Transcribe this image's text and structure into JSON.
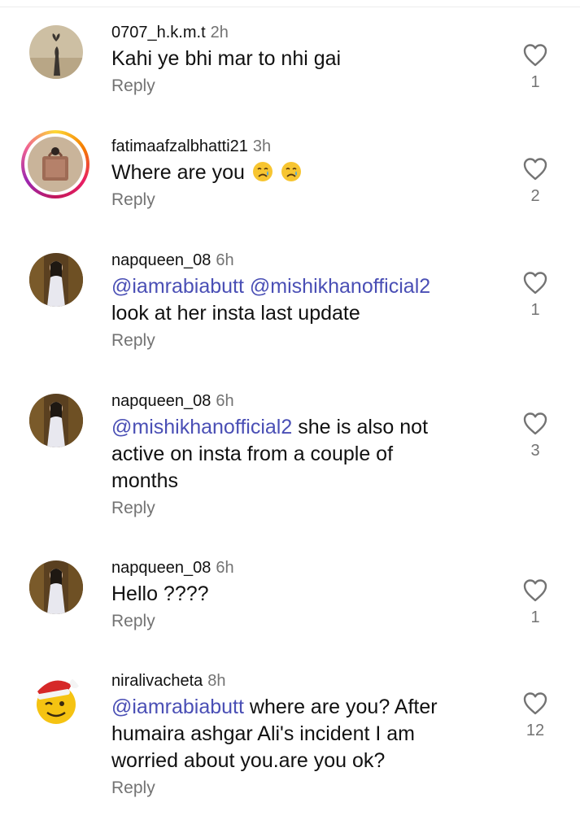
{
  "comments": [
    {
      "username": "0707_h.k.m.t",
      "time": "2h",
      "text_lines": [
        "Kahi ye bhi mar to nhi gai"
      ],
      "reply_label": "Reply",
      "likes": "1"
    },
    {
      "username": "fatimaafzalbhatti21",
      "time": "3h",
      "text": "Where are you",
      "emoji": [
        "😢",
        "😢"
      ],
      "reply_label": "Reply",
      "likes": "2"
    },
    {
      "username": "napqueen_08",
      "time": "6h",
      "mentions": [
        "@iamrabiabutt",
        "@mishikhanofficial2"
      ],
      "text": "look at her insta last update",
      "reply_label": "Reply",
      "likes": "1"
    },
    {
      "username": "napqueen_08",
      "time": "6h",
      "mention": "@mishikhanofficial2",
      "text_first": " she is also not",
      "text_lines": [
        "active on insta from a couple of",
        "months"
      ],
      "reply_label": "Reply",
      "likes": "3"
    },
    {
      "username": "napqueen_08",
      "time": "6h",
      "text": "Hello ????",
      "reply_label": "Reply",
      "likes": "1"
    },
    {
      "username": "niralivacheta",
      "time": "8h",
      "mention": "@iamrabiabutt",
      "text_first": " where are you? After",
      "text_lines": [
        "humaira ashgar Ali's incident I am",
        "worried about you.are you ok?"
      ],
      "reply_label": "Reply",
      "likes": "12"
    }
  ],
  "colors": {
    "mention": "#4a4fb5",
    "secondary_text": "#737373",
    "story_ring": "#e91e63"
  },
  "icons": [
    "heart-outline-icon",
    "crying-face-emoji"
  ]
}
